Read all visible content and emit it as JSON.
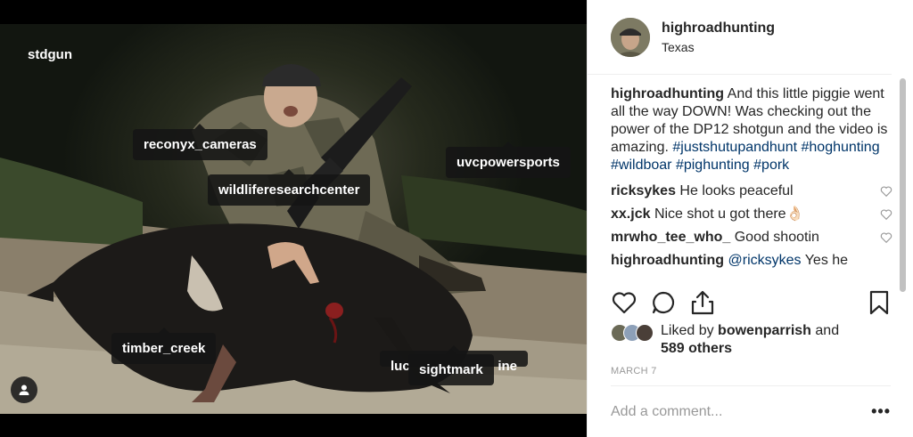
{
  "photo": {
    "tags": [
      {
        "id": "stdgun",
        "label": "stdgun"
      },
      {
        "id": "reconyx",
        "label": "reconyx_cameras"
      },
      {
        "id": "uvc",
        "label": "uvcpowersports"
      },
      {
        "id": "wildlife",
        "label": "wildliferesearchcenter"
      },
      {
        "id": "timber",
        "label": "timber_creek"
      },
      {
        "id": "lucas",
        "label": "lucasoilproducts"
      },
      {
        "id": "lucas_tail",
        "label": "ine"
      },
      {
        "id": "sightmark",
        "label": "sightmark"
      }
    ],
    "user_tags_icon": "user-icon"
  },
  "header": {
    "username": "highroadhunting",
    "location": "Texas"
  },
  "caption": {
    "user": "highroadhunting",
    "text": "And this little piggie went all the way DOWN! Was checking out the power of the DP12 shotgun and the video is amazing.",
    "hashtags": [
      "#justshutupandhunt",
      "#hoghunting",
      "#wildboar",
      "#pighunting",
      "#pork"
    ]
  },
  "comments": [
    {
      "user": "ricksykes",
      "text": "He looks peaceful"
    },
    {
      "user": "xx.jck",
      "text": "Nice shot u got there👌🏻"
    },
    {
      "user": "mrwho_tee_who_",
      "text": "Good shootin"
    },
    {
      "user": "highroadhunting",
      "mention": "@ricksykes",
      "text": "Yes he"
    }
  ],
  "actions": {
    "like_icon": "heart-icon",
    "comment_icon": "comment-icon",
    "share_icon": "share-icon",
    "save_icon": "bookmark-icon"
  },
  "likes": {
    "prefix": "Liked by",
    "user": "bowenparrish",
    "and": "and",
    "others": "589 others"
  },
  "date": "MARCH 7",
  "add_comment": {
    "placeholder": "Add a comment...",
    "more": "•••"
  },
  "colors": {
    "hashtag": "#003569",
    "text": "#262626",
    "muted": "#999999"
  }
}
